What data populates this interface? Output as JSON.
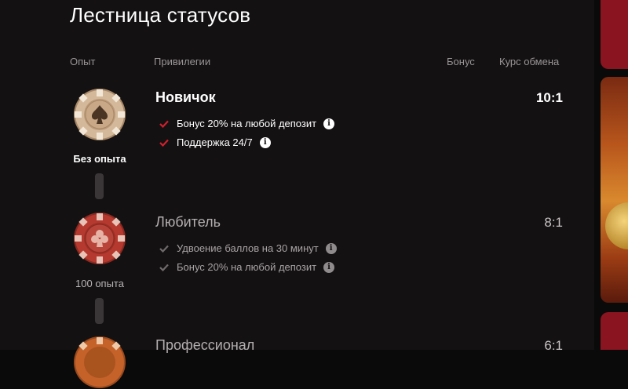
{
  "page_title": "Лестница статусов",
  "columns": {
    "experience": "Опыт",
    "privileges": "Привилегии",
    "bonus": "Бонус",
    "exchange_rate": "Курс обмена"
  },
  "tiers": [
    {
      "name": "Новичок",
      "experience": "Без опыта",
      "rate": "10:1",
      "chip_icon": "spade-icon",
      "perks": [
        "Бонус 20% на любой депозит",
        "Поддержка 24/7"
      ]
    },
    {
      "name": "Любитель",
      "experience": "100 опыта",
      "rate": "8:1",
      "chip_icon": "club-icon",
      "perks": [
        "Удвоение баллов на 30 минут",
        "Бонус 20% на любой депозит"
      ]
    },
    {
      "name": "Профессионал",
      "rate": "6:1",
      "chip_icon": "chip-icon"
    }
  ],
  "colors": {
    "check_active": "#d0202c",
    "check_inactive": "#6f6a6c",
    "chip_beige": "#c9a98a",
    "chip_red": "#b5392e",
    "chip_orange": "#c4622a"
  }
}
